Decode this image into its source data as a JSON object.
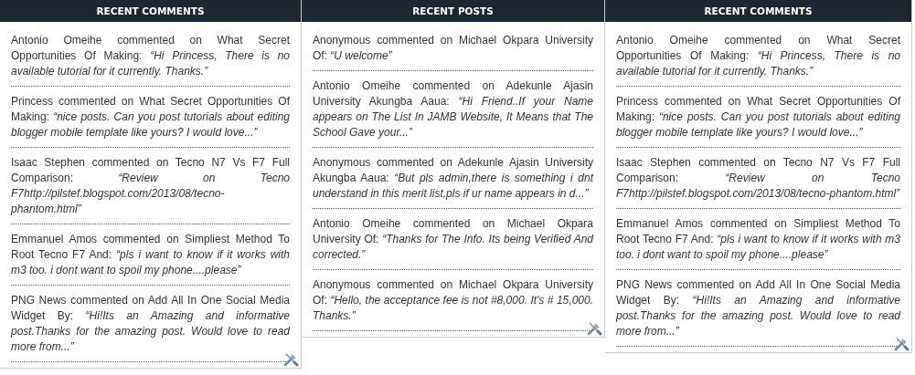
{
  "widgets": [
    {
      "title": "RECENT COMMENTS",
      "items": [
        "Antonio Omeihe commented on What Secret Opportunities Of Making: *“Hi Princess, There is no available tutorial for it currently. Thanks.”*",
        "Princess commented on What Secret Opportunities Of Making: *“nice posts. Can you post tutorials about editing blogger mobile template like yours? I would love...”*",
        "Isaac Stephen commented on Tecno N7 Vs F7 Full Comparison: *“Review on Tecno F7http://pilstef.blogspot.com/2013/08/tecno-phantom.html”*",
        "Emmanuel Amos commented on Simpliest Method To Root Tecno F7 And: *“pls i want to know if it works with m3 too. i dont want to spoil my phone....please”*",
        "PNG News commented on Add All In One Social Media Widget By: *“Hi!Its an Amazing and informative post.Thanks for the amazing post. Would love to read more from...”*"
      ]
    },
    {
      "title": "RECENT POSTS",
      "items": [
        "Anonymous commented on Michael Okpara University Of: *“U welcome”*",
        "Antonio Omeihe commented on Adekunle Ajasin University Akungba Aaua: *“Hi Friend..If your Name appears on The List In JAMB Website, It Means that The School Gave your...”*",
        "Anonymous commented on Adekunle Ajasin University Akungba Aaua: *“But pls admin,there is something i dnt understand in this merit list,pls if ur name appears in d...”*",
        "Antonio Omeihe commented on Michael Okpara University Of: *“Thanks for The Info. Its being Verified And corrected.”*",
        "Anonymous commented on Michael Okpara University Of: *“Hello, the acceptance fee is not #8,000. It's # 15,000. Thanks.”*"
      ]
    },
    {
      "title": "RECENT COMMENTS",
      "items": [
        "Antonio Omeihe commented on What Secret Opportunities Of Making: *“Hi Princess, There is no available tutorial for it currently. Thanks.”*",
        "Princess commented on What Secret Opportunities Of Making: *“nice posts. Can you post tutorials about editing blogger mobile template like yours? I would love...”*",
        "Isaac Stephen commented on Tecno N7 Vs F7 Full Comparison: *“Review on Tecno F7http://pilstef.blogspot.com/2013/08/tecno-phantom.html”*",
        "Emmanuel Amos commented on Simpliest Method To Root Tecno F7 And: *“pls i want to know if it works with m3 too. i dont want to spoil my phone....please”*",
        "PNG News commented on Add All In One Social Media Widget By: *“Hi!Its an Amazing and informative post.Thanks for the amazing post. Would love to read more from...”*"
      ]
    }
  ]
}
